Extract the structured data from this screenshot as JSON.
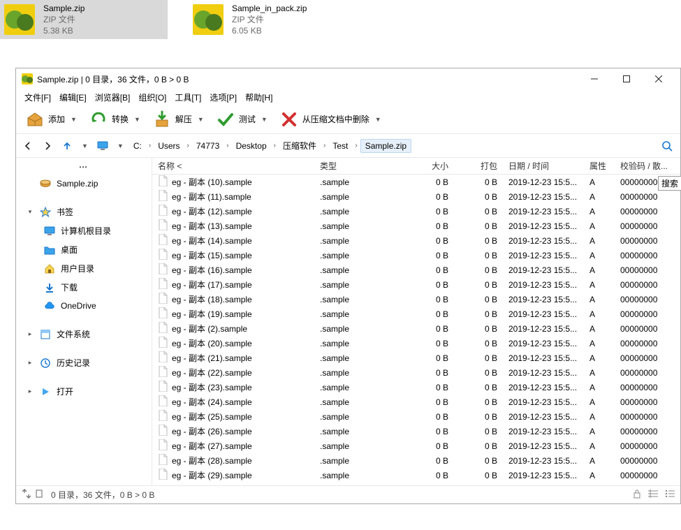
{
  "desktop": {
    "files": [
      {
        "name": "Sample.zip",
        "type": "ZIP 文件",
        "size": "5.38 KB",
        "selected": true
      },
      {
        "name": "Sample_in_pack.zip",
        "type": "ZIP 文件",
        "size": "6.05 KB",
        "selected": false
      }
    ]
  },
  "window": {
    "title": "Sample.zip | 0 目录，36 文件，0 B > 0 B",
    "menu": [
      {
        "label": "文件[F]"
      },
      {
        "label": "编辑[E]"
      },
      {
        "label": "浏览器[B]"
      },
      {
        "label": "组织[O]"
      },
      {
        "label": "工具[T]"
      },
      {
        "label": "选项[P]"
      },
      {
        "label": "帮助[H]"
      }
    ],
    "toolbar": {
      "add": "添加",
      "convert": "转换",
      "extract": "解压",
      "test": "测试",
      "delete": "从压缩文档中删除"
    },
    "breadcrumbs": [
      "C:",
      "Users",
      "74773",
      "Desktop",
      "压缩软件",
      "Test",
      "Sample.zip"
    ],
    "tooltip": "搜索",
    "sidebar": {
      "archive": "Sample.zip",
      "bookmarks": "书签",
      "bookmark_items": [
        {
          "label": "计算机根目录",
          "icon": "monitor"
        },
        {
          "label": "桌面",
          "icon": "folder-blue"
        },
        {
          "label": "用户目录",
          "icon": "home"
        },
        {
          "label": "下载",
          "icon": "download"
        },
        {
          "label": "OneDrive",
          "icon": "cloud"
        }
      ],
      "filesystem": "文件系统",
      "history": "历史记录",
      "open": "打开"
    },
    "columns": {
      "name": "名称 <",
      "type": "类型",
      "size": "大小",
      "pack": "打包",
      "date": "日期 / 时间",
      "attr": "属性",
      "checksum": "校验码 / 散..."
    },
    "files": [
      {
        "name": "eg - 副本 (10).sample",
        "type": ".sample",
        "size": "0 B",
        "pack": "0 B",
        "date": "2019-12-23 15:5...",
        "attr": "A",
        "chk": "00000000"
      },
      {
        "name": "eg - 副本 (11).sample",
        "type": ".sample",
        "size": "0 B",
        "pack": "0 B",
        "date": "2019-12-23 15:5...",
        "attr": "A",
        "chk": "00000000"
      },
      {
        "name": "eg - 副本 (12).sample",
        "type": ".sample",
        "size": "0 B",
        "pack": "0 B",
        "date": "2019-12-23 15:5...",
        "attr": "A",
        "chk": "00000000"
      },
      {
        "name": "eg - 副本 (13).sample",
        "type": ".sample",
        "size": "0 B",
        "pack": "0 B",
        "date": "2019-12-23 15:5...",
        "attr": "A",
        "chk": "00000000"
      },
      {
        "name": "eg - 副本 (14).sample",
        "type": ".sample",
        "size": "0 B",
        "pack": "0 B",
        "date": "2019-12-23 15:5...",
        "attr": "A",
        "chk": "00000000"
      },
      {
        "name": "eg - 副本 (15).sample",
        "type": ".sample",
        "size": "0 B",
        "pack": "0 B",
        "date": "2019-12-23 15:5...",
        "attr": "A",
        "chk": "00000000"
      },
      {
        "name": "eg - 副本 (16).sample",
        "type": ".sample",
        "size": "0 B",
        "pack": "0 B",
        "date": "2019-12-23 15:5...",
        "attr": "A",
        "chk": "00000000"
      },
      {
        "name": "eg - 副本 (17).sample",
        "type": ".sample",
        "size": "0 B",
        "pack": "0 B",
        "date": "2019-12-23 15:5...",
        "attr": "A",
        "chk": "00000000"
      },
      {
        "name": "eg - 副本 (18).sample",
        "type": ".sample",
        "size": "0 B",
        "pack": "0 B",
        "date": "2019-12-23 15:5...",
        "attr": "A",
        "chk": "00000000"
      },
      {
        "name": "eg - 副本 (19).sample",
        "type": ".sample",
        "size": "0 B",
        "pack": "0 B",
        "date": "2019-12-23 15:5...",
        "attr": "A",
        "chk": "00000000"
      },
      {
        "name": "eg - 副本 (2).sample",
        "type": ".sample",
        "size": "0 B",
        "pack": "0 B",
        "date": "2019-12-23 15:5...",
        "attr": "A",
        "chk": "00000000"
      },
      {
        "name": "eg - 副本 (20).sample",
        "type": ".sample",
        "size": "0 B",
        "pack": "0 B",
        "date": "2019-12-23 15:5...",
        "attr": "A",
        "chk": "00000000"
      },
      {
        "name": "eg - 副本 (21).sample",
        "type": ".sample",
        "size": "0 B",
        "pack": "0 B",
        "date": "2019-12-23 15:5...",
        "attr": "A",
        "chk": "00000000"
      },
      {
        "name": "eg - 副本 (22).sample",
        "type": ".sample",
        "size": "0 B",
        "pack": "0 B",
        "date": "2019-12-23 15:5...",
        "attr": "A",
        "chk": "00000000"
      },
      {
        "name": "eg - 副本 (23).sample",
        "type": ".sample",
        "size": "0 B",
        "pack": "0 B",
        "date": "2019-12-23 15:5...",
        "attr": "A",
        "chk": "00000000"
      },
      {
        "name": "eg - 副本 (24).sample",
        "type": ".sample",
        "size": "0 B",
        "pack": "0 B",
        "date": "2019-12-23 15:5...",
        "attr": "A",
        "chk": "00000000"
      },
      {
        "name": "eg - 副本 (25).sample",
        "type": ".sample",
        "size": "0 B",
        "pack": "0 B",
        "date": "2019-12-23 15:5...",
        "attr": "A",
        "chk": "00000000"
      },
      {
        "name": "eg - 副本 (26).sample",
        "type": ".sample",
        "size": "0 B",
        "pack": "0 B",
        "date": "2019-12-23 15:5...",
        "attr": "A",
        "chk": "00000000"
      },
      {
        "name": "eg - 副本 (27).sample",
        "type": ".sample",
        "size": "0 B",
        "pack": "0 B",
        "date": "2019-12-23 15:5...",
        "attr": "A",
        "chk": "00000000"
      },
      {
        "name": "eg - 副本 (28).sample",
        "type": ".sample",
        "size": "0 B",
        "pack": "0 B",
        "date": "2019-12-23 15:5...",
        "attr": "A",
        "chk": "00000000"
      },
      {
        "name": "eg - 副本 (29).sample",
        "type": ".sample",
        "size": "0 B",
        "pack": "0 B",
        "date": "2019-12-23 15:5...",
        "attr": "A",
        "chk": "00000000"
      }
    ],
    "status": "0 目录，36 文件，0 B > 0 B"
  }
}
